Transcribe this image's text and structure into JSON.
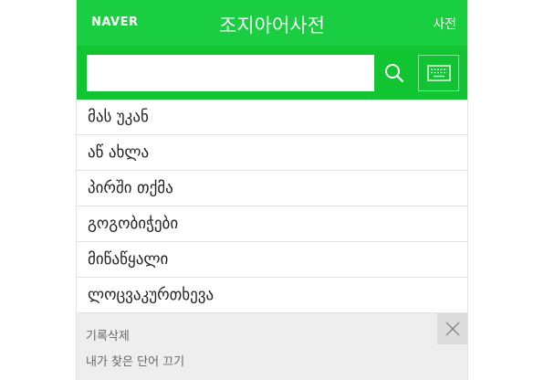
{
  "header": {
    "logo": "NAVER",
    "title": "조지아어사전",
    "link_label": "사전"
  },
  "search": {
    "value": "",
    "placeholder": ""
  },
  "words": [
    "მას უკან",
    "აწ ახლა",
    "პირში თქმა",
    "გოგობიჭები",
    "მიწაწყალი",
    "ლოცვაკურთხევა"
  ],
  "history": {
    "delete_label": "기록삭제",
    "hint": "내가 찾은 단어 끄기"
  },
  "colors": {
    "brand_green": "#19ce40",
    "search_bar_green": "#11c532",
    "history_bg": "#eeeeee"
  }
}
